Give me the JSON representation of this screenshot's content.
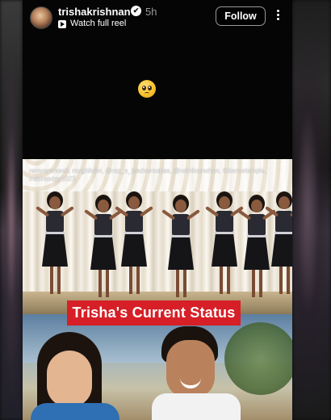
{
  "post": {
    "username": "trishakrishnan",
    "verified_icon": "✔",
    "time": "5h",
    "watch_reel_label": "Watch full reel",
    "follow_label": "Follow",
    "caption_emoji": "pleading-face-emoji"
  },
  "image": {
    "overlay_caption": "remyaramesh, mughilravi, @rap_s_leadsersabas, @rathikamohan, ©dancetemple, madrasday2023",
    "banner_text": "Trisha's Current Status",
    "banner_color": "#d61f26"
  }
}
